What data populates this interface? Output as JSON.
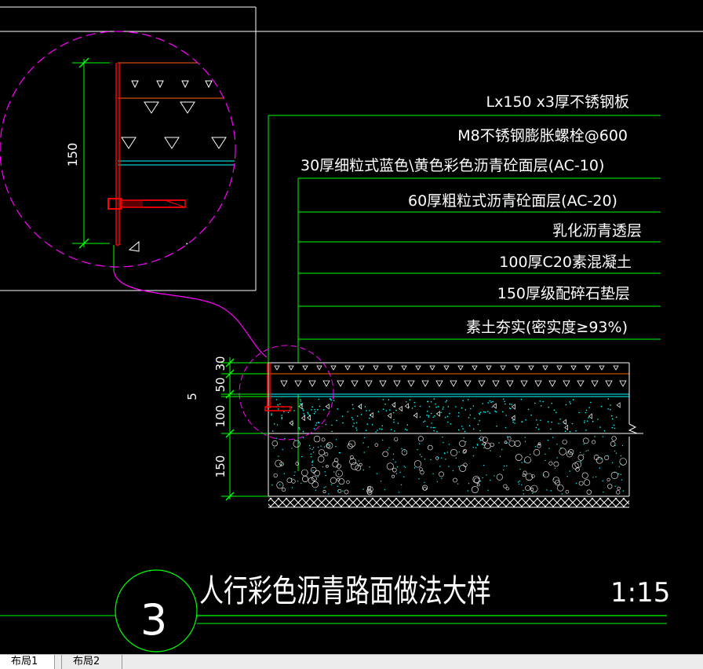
{
  "drawing": {
    "labels": [
      "Lx150 x3厚不锈钢板",
      "M8不锈钢膨胀螺栓@600",
      "30厚细粒式蓝色\\黄色彩色沥青砼面层(AC-10)",
      "60厚粗粒式沥青砼面层(AC-20)",
      "乳化沥青透层",
      "100厚C20素混凝土",
      "150厚级配碎石垫层",
      "素土夯实(密实度≥93%)"
    ],
    "detail_dim": "150",
    "dims": {
      "d30": "30",
      "d50": "50",
      "d5": "5",
      "d100": "100",
      "d150": "150"
    },
    "title": "人行彩色沥青路面做法大样",
    "scale": "1:15",
    "index_number": "3"
  },
  "tabs": [
    "布局1",
    "布局2"
  ],
  "colors": {
    "background": "#000000",
    "leader": "#00ff00",
    "detail_circle": "#ff00ff",
    "steel_plate": "#ff0000",
    "ac10_line": "#ff6600",
    "asphalt_boundary": "#00ffff",
    "concrete_dots": "#00ffff"
  }
}
